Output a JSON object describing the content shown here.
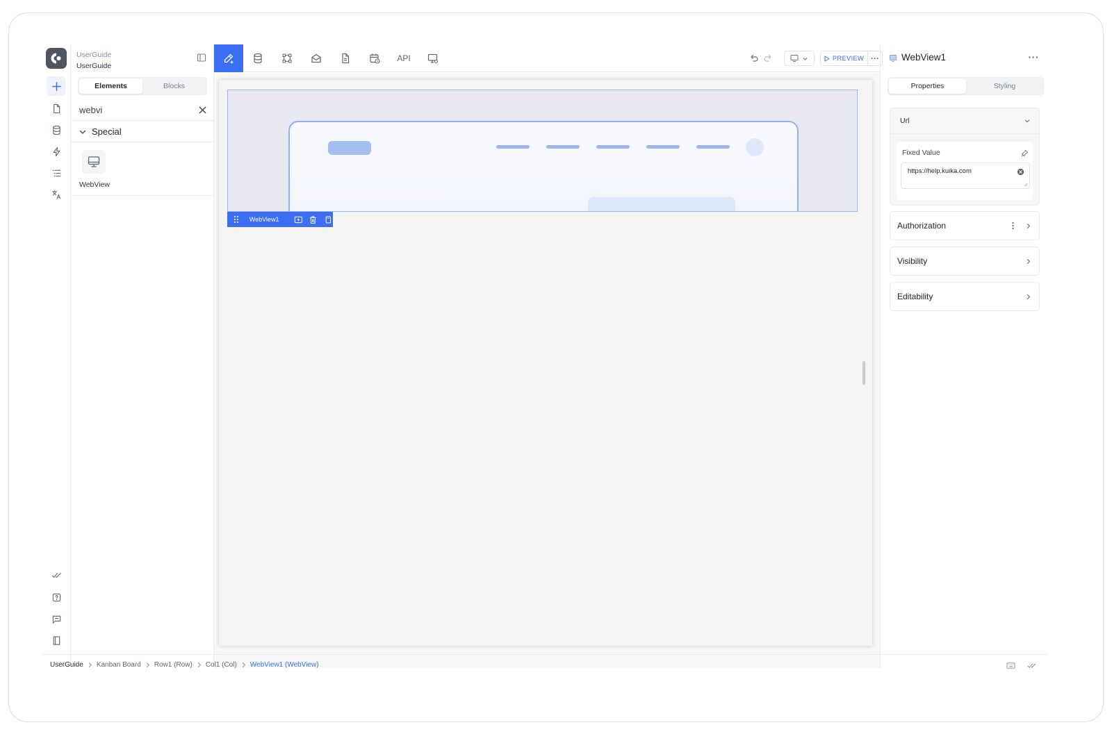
{
  "project": {
    "label": "UserGuide",
    "name": "UserGuide"
  },
  "elements_panel": {
    "tabs": [
      {
        "label": "Elements"
      },
      {
        "label": "Blocks"
      }
    ],
    "search_value": "webvi",
    "group_label": "Special",
    "result_label": "WebView"
  },
  "toolbar": {
    "api_label": "API",
    "preview_label": "PREVIEW",
    "more_label": "···"
  },
  "canvas": {
    "selected_tag": "WebView1"
  },
  "properties": {
    "title": "WebView1",
    "more_label": "···",
    "tabs": [
      {
        "label": "Properties"
      },
      {
        "label": "Styling"
      }
    ],
    "url": {
      "section_label": "Url",
      "field_label": "Fixed Value",
      "value": "https://help.kuika.com"
    },
    "sections": [
      {
        "label": "Authorization"
      },
      {
        "label": "Visibility"
      },
      {
        "label": "Editability"
      }
    ]
  },
  "breadcrumb": [
    {
      "label": "UserGuide"
    },
    {
      "label": "Kanban Board"
    },
    {
      "label": "Row1 (Row)"
    },
    {
      "label": "Col1 (Col)"
    },
    {
      "label": "WebView1 (WebView)"
    }
  ],
  "colors": {
    "accent": "#3b6ef5",
    "rail_logo": "#50565f",
    "mock_line": "#9db5f0"
  }
}
